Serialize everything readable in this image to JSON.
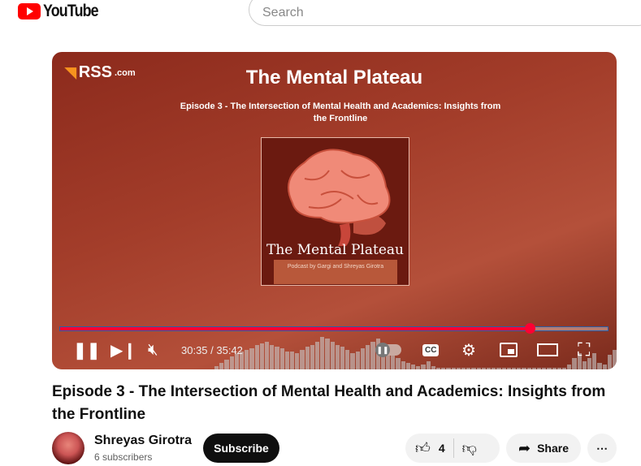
{
  "header": {
    "logo_text": "YouTube",
    "search_placeholder": "Search"
  },
  "player": {
    "brand": "RSS",
    "brand_suffix": ".com",
    "video_title": "The Mental Plateau",
    "video_subtitle": "Episode 3 - The Intersection of Mental Health and Academics: Insights from the Frontline",
    "art_title": "The Mental Plateau",
    "art_caption": "Podcast by Gargi and Shreyas Girotra",
    "current_time": "30:35",
    "duration": "35:42",
    "time_display": "30:35 / 35:42",
    "progress": 0.857,
    "muted": true,
    "playing": true,
    "progress_color": "#ff0033",
    "cc_label": "CC"
  },
  "video": {
    "title": "Episode 3 - The Intersection of Mental Health and Academics: Insights from the Frontline"
  },
  "channel": {
    "name": "Shreyas Girotra",
    "subscribers": "6 subscribers",
    "subscribe_label": "Subscribe"
  },
  "actions": {
    "likes": "4",
    "share_label": "Share",
    "more_label": "⋯"
  }
}
